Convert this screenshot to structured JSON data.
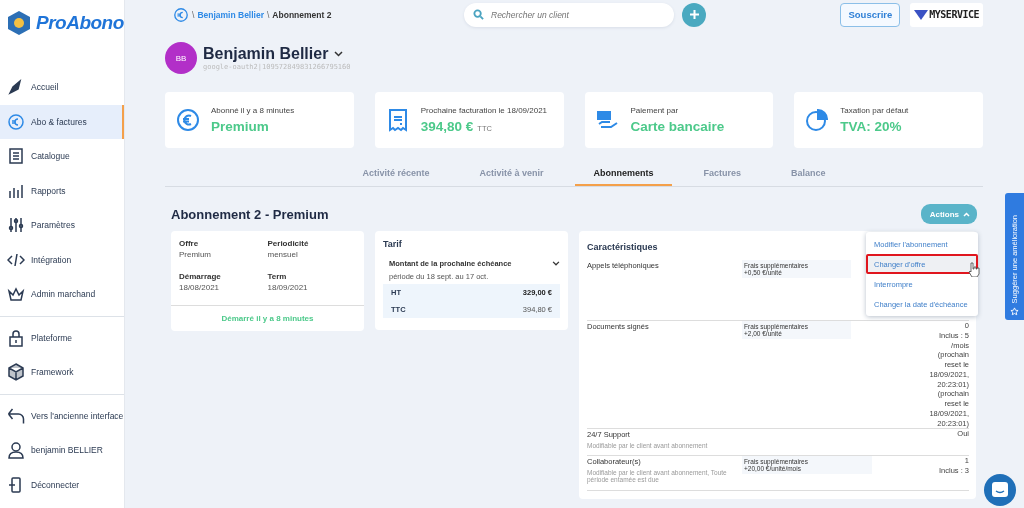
{
  "logo": {
    "text": "ProAbono"
  },
  "sidebar": {
    "groups": [
      [
        {
          "label": "Accueil",
          "selected": false
        },
        {
          "label": "Abo & factures",
          "selected": true
        },
        {
          "label": "Catalogue",
          "selected": false
        },
        {
          "label": "Rapports",
          "selected": false
        },
        {
          "label": "Paramètres",
          "selected": false
        },
        {
          "label": "Intégration",
          "selected": false
        },
        {
          "label": "Admin marchand",
          "selected": false
        }
      ],
      [
        {
          "label": "Plateforme",
          "selected": false
        },
        {
          "label": "Framework",
          "selected": false
        }
      ],
      [
        {
          "label": "Vers l'ancienne interface",
          "selected": false
        },
        {
          "label": "benjamin BELLIER",
          "selected": false
        },
        {
          "label": "Déconnecter",
          "selected": false
        }
      ]
    ]
  },
  "breadcrumb": [
    {
      "separator": "\\",
      "label": "Benjamin Bellier"
    },
    {
      "separator": "\\",
      "label": "Abonnement 2"
    }
  ],
  "search": {
    "placeholder": "Rechercher un client"
  },
  "subscribe_button": "Souscrire",
  "brand": "MYSERVICE",
  "customer": {
    "initials": "BB",
    "name": "Benjamin Bellier",
    "id": "google-oauth2|109572849831266795160"
  },
  "summary_cards": [
    {
      "label": "Abonné il y a 8 minutes",
      "value": "Premium"
    },
    {
      "label": "Prochaine facturation le 18/09/2021",
      "value": "394,80 €",
      "suffix": "TTC"
    },
    {
      "label": "Paiement par",
      "value": "Carte bancaire"
    },
    {
      "label": "Taxation par défaut",
      "value": "TVA: 20%"
    }
  ],
  "tabs": [
    {
      "label": "Activité récente",
      "selected": false
    },
    {
      "label": "Activité à venir",
      "selected": false
    },
    {
      "label": "Abonnements",
      "selected": true
    },
    {
      "label": "Factures",
      "selected": false
    },
    {
      "label": "Balance",
      "selected": false
    }
  ],
  "subscription": {
    "title": "Abonnement 2 - Premium",
    "actions_button": "Actions",
    "details": {
      "fields": [
        {
          "label": "Offre",
          "value": "Premium"
        },
        {
          "label": "Periodicité",
          "value": "mensuel"
        },
        {
          "label": "Démarrage",
          "value": "18/08/2021"
        },
        {
          "label": "Term",
          "value": "18/09/2021"
        }
      ],
      "footer": "Démarré il y a 8 minutes"
    },
    "tarif": {
      "title": "Tarif",
      "heading": "Montant de la prochaine échéance",
      "period": "période du 18 sept. au 17 oct.",
      "rows": [
        {
          "label": "HT",
          "amount": "329,00 €",
          "bold": true
        },
        {
          "label": "TTC",
          "amount": "394,80 €",
          "bold": false
        }
      ]
    },
    "features": {
      "title": "Caractéristiques",
      "rows": [
        {
          "name": "Appels téléphoniques",
          "fee": [
            "Frais supplémentaires",
            "+0,50 €/unité"
          ]
        },
        {
          "name": "Documents signés",
          "fee": [
            "Frais supplémentaires",
            "+2,00 €/unité"
          ],
          "value": [
            "0",
            "Inclus : 5",
            "/mois",
            "(prochain",
            "reset le",
            "18/09/2021,",
            "20:23:01)",
            "(prochain",
            "reset le",
            "18/09/2021,",
            "20:23:01)"
          ]
        },
        {
          "name": "24/7 Support",
          "note": "Modifiable par le client avant abonnement",
          "value": [
            "Oui"
          ]
        },
        {
          "name": "Collaborateur(s)",
          "note": "Modifiable par le client avant abonnement, Toute période entamée est due",
          "fee": [
            "Frais supplémentaires",
            "+20,00 €/unité/mois"
          ],
          "value": [
            "1",
            "Inclus : 3"
          ]
        }
      ]
    }
  },
  "actions_menu": [
    {
      "label": "Modifier l'abonnement",
      "selected": false
    },
    {
      "label": "Changer d'offre",
      "selected": true
    },
    {
      "label": "Interrompre",
      "selected": false
    },
    {
      "label": "Changer la date d'échéance",
      "selected": false
    }
  ],
  "feedback_tab": "Suggérer une amélioration"
}
